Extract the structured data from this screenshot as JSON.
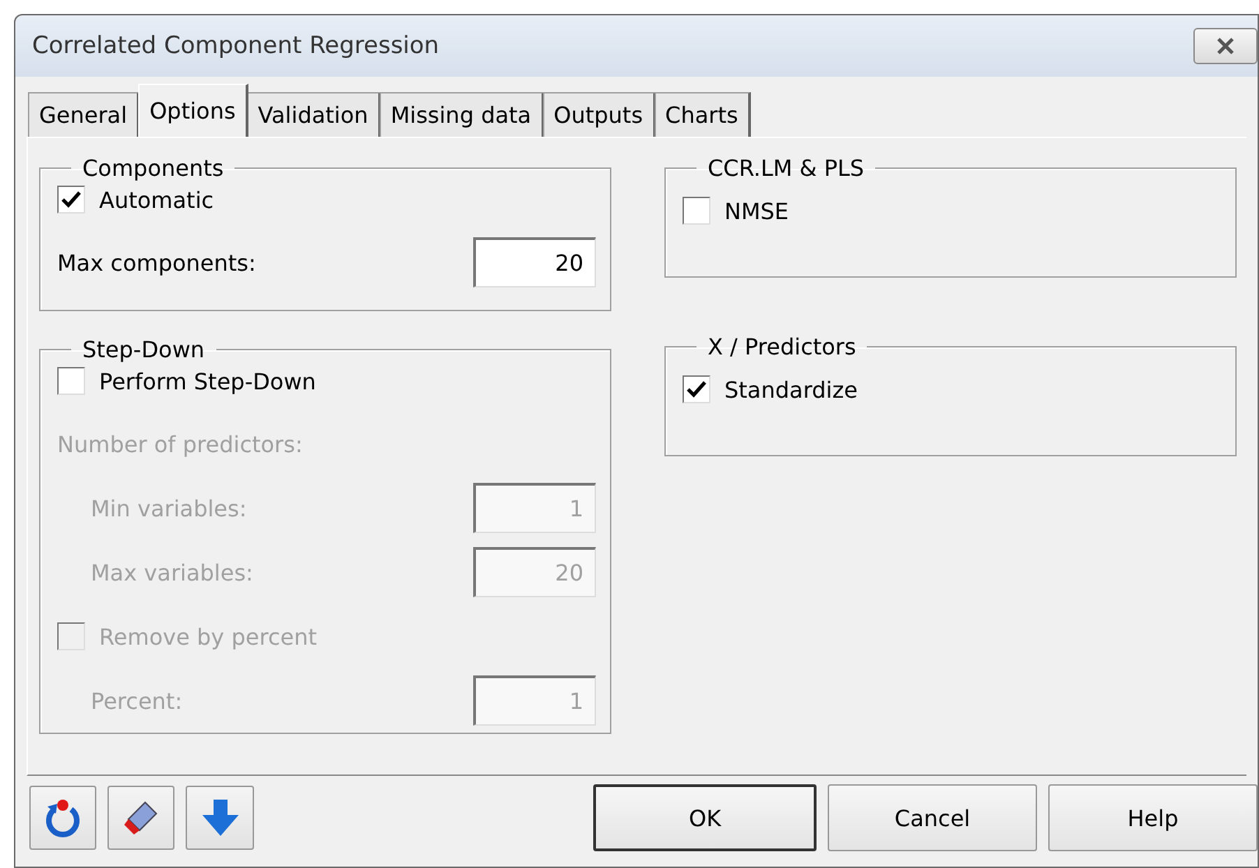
{
  "window": {
    "title": "Correlated Component Regression"
  },
  "tabs": [
    {
      "label": "General",
      "selected": false
    },
    {
      "label": "Options",
      "selected": true
    },
    {
      "label": "Validation",
      "selected": false
    },
    {
      "label": "Missing data",
      "selected": false
    },
    {
      "label": "Outputs",
      "selected": false
    },
    {
      "label": "Charts",
      "selected": false
    }
  ],
  "columns": [
    [
      {
        "title": "Components",
        "items": [
          {
            "kind": "checkbox",
            "label": "Automatic",
            "checked": true,
            "disabled": false
          },
          {
            "kind": "field",
            "label": "Max components:",
            "value": "20",
            "disabled": false
          }
        ]
      },
      {
        "title": "Step-Down",
        "items": [
          {
            "kind": "checkbox",
            "label": "Perform Step-Down",
            "checked": false,
            "disabled": false
          },
          {
            "kind": "label",
            "label": "Number of predictors:",
            "disabled": true,
            "children": [
              {
                "kind": "field",
                "label": "Min variables:",
                "value": "1",
                "disabled": true
              },
              {
                "kind": "field",
                "label": "Max variables:",
                "value": "20",
                "disabled": true
              }
            ]
          },
          {
            "kind": "checkbox",
            "label": "Remove by percent",
            "checked": false,
            "disabled": true,
            "children": [
              {
                "kind": "field",
                "label": "Percent:",
                "value": "1",
                "disabled": true
              }
            ]
          }
        ]
      }
    ],
    [
      {
        "title": "CCR.LM & PLS",
        "items": [
          {
            "kind": "checkbox",
            "label": "NMSE",
            "checked": false,
            "disabled": false
          }
        ]
      },
      {
        "title": "X / Predictors",
        "items": [
          {
            "kind": "checkbox",
            "label": "Standardize",
            "checked": true,
            "disabled": false
          }
        ]
      }
    ]
  ],
  "buttons": [
    "OK",
    "Cancel",
    "Help"
  ]
}
